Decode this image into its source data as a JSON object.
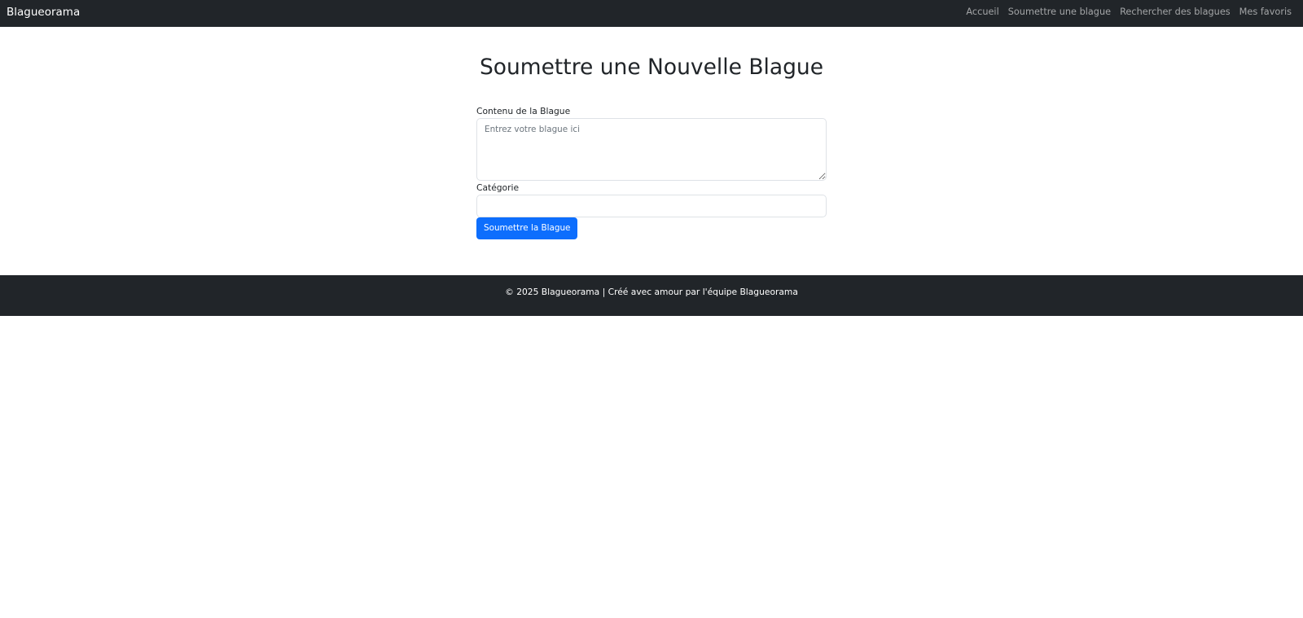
{
  "navbar": {
    "brand": "Blagueorama",
    "links": [
      {
        "label": "Accueil"
      },
      {
        "label": "Soumettre une blague"
      },
      {
        "label": "Rechercher des blagues"
      },
      {
        "label": "Mes favoris"
      }
    ]
  },
  "main": {
    "title": "Soumettre une Nouvelle Blague",
    "form": {
      "content_label": "Contenu de la Blague",
      "content_placeholder": "Entrez votre blague ici",
      "content_value": "",
      "category_label": "Catégorie",
      "category_value": "",
      "submit_label": "Soumettre la Blague"
    }
  },
  "footer": {
    "text": "© 2025 Blagueorama | Créé avec amour par l'équipe Blagueorama"
  },
  "colors": {
    "navbar_bg": "#212529",
    "primary_button": "#0d6efd",
    "footer_bg": "#212529"
  }
}
